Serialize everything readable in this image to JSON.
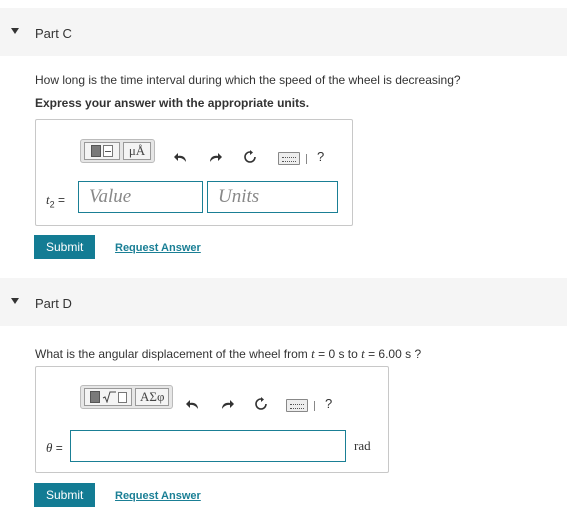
{
  "partC": {
    "title": "Part C",
    "question": "How long is the time interval during which the speed of the wheel is decreasing?",
    "instruction": "Express your answer with the appropriate units.",
    "toolbar": {
      "mu_label": "μÅ",
      "help": "?"
    },
    "variable": "t",
    "subscript": "2",
    "equals": " =",
    "value_placeholder": "Value",
    "units_placeholder": "Units",
    "submit_label": "Submit",
    "request_label": "Request Answer"
  },
  "partD": {
    "title": "Part D",
    "question_prefix": "What is the angular displacement of the wheel from ",
    "t_var": "t",
    "t0": " = 0 s to ",
    "t_var2": "t",
    "t1": " = 6.00 s ?",
    "toolbar": {
      "greek_label": "ΑΣφ",
      "help": "?"
    },
    "variable": "θ",
    "equals": " =",
    "unit": "rad",
    "submit_label": "Submit",
    "request_label": "Request Answer"
  },
  "colors": {
    "accent": "#137c94",
    "header_bg": "#f5f5f5"
  },
  "icons": [
    "collapse-triangle-icon",
    "templates-icon",
    "undo-icon",
    "redo-icon",
    "reset-icon",
    "keyboard-icon"
  ]
}
